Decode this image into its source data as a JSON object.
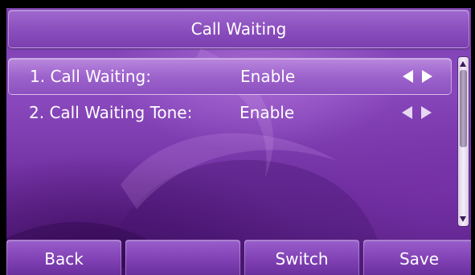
{
  "title": "Call Waiting",
  "items": [
    {
      "label": "1. Call Waiting:",
      "value": "Enable",
      "selected": true
    },
    {
      "label": "2. Call Waiting Tone:",
      "value": "Enable",
      "selected": false
    }
  ],
  "softkeys": {
    "back": "Back",
    "empty": "",
    "switch": "Switch",
    "save": "Save"
  },
  "colors": {
    "background": "#7c3fb2",
    "highlight": "#9d63cc",
    "text": "#ffffff"
  },
  "icons": {
    "left_arrow": "left-triangle-icon",
    "right_arrow": "right-triangle-icon",
    "scroll_up": "scroll-up-arrow-icon",
    "scroll_down": "scroll-down-arrow-icon"
  }
}
